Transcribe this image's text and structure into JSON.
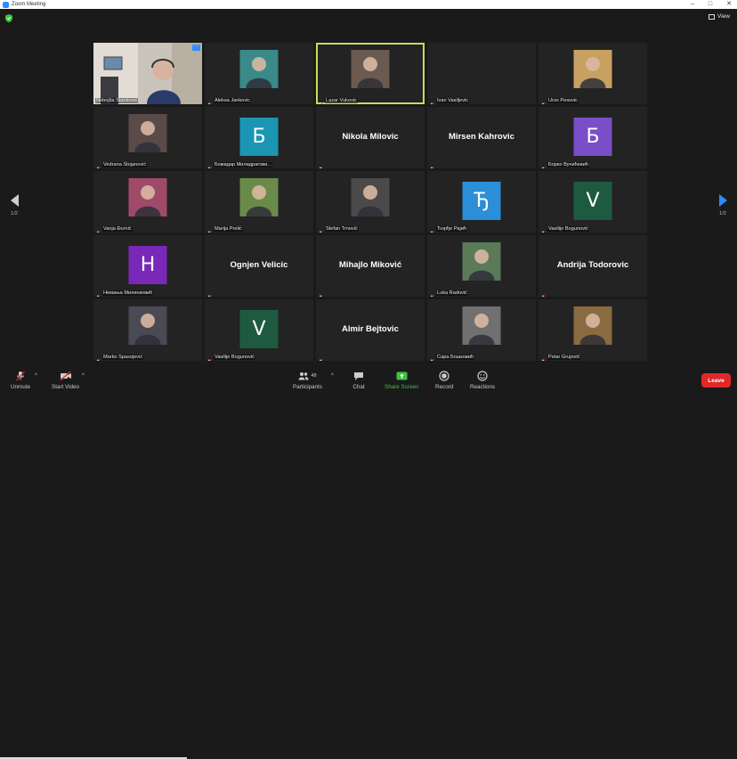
{
  "window": {
    "title": "Zoom Meeting",
    "controls": [
      "–",
      "□",
      "✕"
    ]
  },
  "view_label": "View",
  "pager": {
    "left": "1/2",
    "right": "1/2"
  },
  "tiles": [
    {
      "name": "Nebojša Stanković",
      "kind": "photo-full",
      "muted": false,
      "more": "···"
    },
    {
      "name": "Aleksa Jankovic",
      "kind": "photo",
      "photo_color": "#3a8a8a"
    },
    {
      "name": "Lazar Vukovic",
      "kind": "photo",
      "photo_color": "#6a5a50",
      "active": true
    },
    {
      "name": "Ivan Vasiljevic",
      "kind": "empty"
    },
    {
      "name": "Uros Pesovic",
      "kind": "photo",
      "photo_color": "#c8a060"
    },
    {
      "name": "Vedrana Stojanović",
      "kind": "photo",
      "photo_color": "#5a4a48"
    },
    {
      "name": "Божидар Милидрагови...",
      "kind": "letter",
      "letter": "Б",
      "color": "#1a96b4"
    },
    {
      "name": "",
      "kind": "bigname",
      "big": "Nikola Milovic"
    },
    {
      "name": "",
      "kind": "bigname",
      "big": "Mirsen Kahrovic"
    },
    {
      "name": "Борко Вучићевић",
      "kind": "letter",
      "letter": "Б",
      "color": "#7a4ec8"
    },
    {
      "name": "Vanja Đurnić",
      "kind": "photo",
      "photo_color": "#a04a6a"
    },
    {
      "name": "Marija Prelić",
      "kind": "photo",
      "photo_color": "#6a8a4a"
    },
    {
      "name": "Stefan Trnović",
      "kind": "photo",
      "photo_color": "#4a4a4a"
    },
    {
      "name": "Ђорђе Рајић",
      "kind": "letter",
      "letter": "Ђ",
      "color": "#2b8ed8"
    },
    {
      "name": "Vasilije Bogunović",
      "kind": "letter",
      "letter": "V",
      "color": "#1e5a40"
    },
    {
      "name": "Немања Милинковић",
      "kind": "letter",
      "letter": "Н",
      "color": "#7a28b8"
    },
    {
      "name": "",
      "kind": "bigname",
      "big": "Ognjen Velicic"
    },
    {
      "name": "",
      "kind": "bigname",
      "big": "Mihajlo Miković"
    },
    {
      "name": "Luka Radović",
      "kind": "photo",
      "photo_color": "#5a7a5a"
    },
    {
      "name": "",
      "kind": "bigname",
      "big": "Andrija Todorovic"
    },
    {
      "name": "Marko Spasojević",
      "kind": "photo",
      "photo_color": "#4a4a55"
    },
    {
      "name": "Vasilije Bogunović",
      "kind": "letter",
      "letter": "V",
      "color": "#1e5a40"
    },
    {
      "name": "",
      "kind": "bigname",
      "big": "Almir Bejtovic"
    },
    {
      "name": "Сара Бошковић",
      "kind": "photo",
      "photo_color": "#707070"
    },
    {
      "name": "Petar Grujović",
      "kind": "photo",
      "photo_color": "#8a6a40"
    }
  ],
  "toolbar": {
    "unmute": "Unmute",
    "start_video": "Start Video",
    "participants": "Participants",
    "participant_count": "48",
    "chat": "Chat",
    "share_screen": "Share Screen",
    "record": "Record",
    "reactions": "Reactions",
    "leave": "Leave"
  },
  "colors": {
    "accent": "#2d8cff",
    "active_border": "#c8dc5a",
    "share_green": "#3fc13f",
    "leave_red": "#e02828"
  }
}
